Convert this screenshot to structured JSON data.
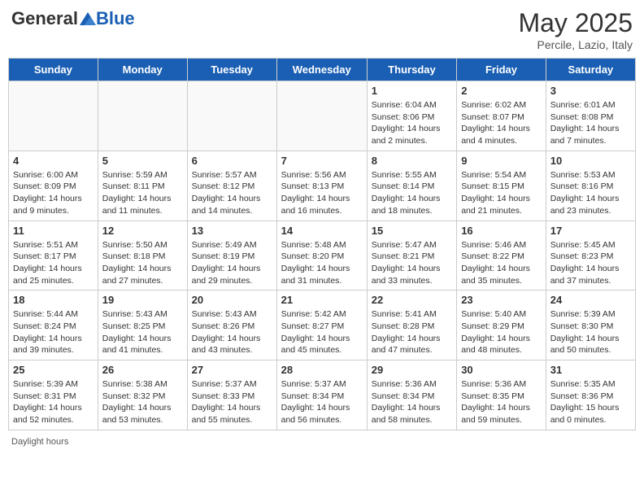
{
  "header": {
    "logo_general": "General",
    "logo_blue": "Blue",
    "month_title": "May 2025",
    "location": "Percile, Lazio, Italy"
  },
  "days_of_week": [
    "Sunday",
    "Monday",
    "Tuesday",
    "Wednesday",
    "Thursday",
    "Friday",
    "Saturday"
  ],
  "weeks": [
    [
      {
        "day": "",
        "info": ""
      },
      {
        "day": "",
        "info": ""
      },
      {
        "day": "",
        "info": ""
      },
      {
        "day": "",
        "info": ""
      },
      {
        "day": "1",
        "info": "Sunrise: 6:04 AM\nSunset: 8:06 PM\nDaylight: 14 hours\nand 2 minutes."
      },
      {
        "day": "2",
        "info": "Sunrise: 6:02 AM\nSunset: 8:07 PM\nDaylight: 14 hours\nand 4 minutes."
      },
      {
        "day": "3",
        "info": "Sunrise: 6:01 AM\nSunset: 8:08 PM\nDaylight: 14 hours\nand 7 minutes."
      }
    ],
    [
      {
        "day": "4",
        "info": "Sunrise: 6:00 AM\nSunset: 8:09 PM\nDaylight: 14 hours\nand 9 minutes."
      },
      {
        "day": "5",
        "info": "Sunrise: 5:59 AM\nSunset: 8:11 PM\nDaylight: 14 hours\nand 11 minutes."
      },
      {
        "day": "6",
        "info": "Sunrise: 5:57 AM\nSunset: 8:12 PM\nDaylight: 14 hours\nand 14 minutes."
      },
      {
        "day": "7",
        "info": "Sunrise: 5:56 AM\nSunset: 8:13 PM\nDaylight: 14 hours\nand 16 minutes."
      },
      {
        "day": "8",
        "info": "Sunrise: 5:55 AM\nSunset: 8:14 PM\nDaylight: 14 hours\nand 18 minutes."
      },
      {
        "day": "9",
        "info": "Sunrise: 5:54 AM\nSunset: 8:15 PM\nDaylight: 14 hours\nand 21 minutes."
      },
      {
        "day": "10",
        "info": "Sunrise: 5:53 AM\nSunset: 8:16 PM\nDaylight: 14 hours\nand 23 minutes."
      }
    ],
    [
      {
        "day": "11",
        "info": "Sunrise: 5:51 AM\nSunset: 8:17 PM\nDaylight: 14 hours\nand 25 minutes."
      },
      {
        "day": "12",
        "info": "Sunrise: 5:50 AM\nSunset: 8:18 PM\nDaylight: 14 hours\nand 27 minutes."
      },
      {
        "day": "13",
        "info": "Sunrise: 5:49 AM\nSunset: 8:19 PM\nDaylight: 14 hours\nand 29 minutes."
      },
      {
        "day": "14",
        "info": "Sunrise: 5:48 AM\nSunset: 8:20 PM\nDaylight: 14 hours\nand 31 minutes."
      },
      {
        "day": "15",
        "info": "Sunrise: 5:47 AM\nSunset: 8:21 PM\nDaylight: 14 hours\nand 33 minutes."
      },
      {
        "day": "16",
        "info": "Sunrise: 5:46 AM\nSunset: 8:22 PM\nDaylight: 14 hours\nand 35 minutes."
      },
      {
        "day": "17",
        "info": "Sunrise: 5:45 AM\nSunset: 8:23 PM\nDaylight: 14 hours\nand 37 minutes."
      }
    ],
    [
      {
        "day": "18",
        "info": "Sunrise: 5:44 AM\nSunset: 8:24 PM\nDaylight: 14 hours\nand 39 minutes."
      },
      {
        "day": "19",
        "info": "Sunrise: 5:43 AM\nSunset: 8:25 PM\nDaylight: 14 hours\nand 41 minutes."
      },
      {
        "day": "20",
        "info": "Sunrise: 5:43 AM\nSunset: 8:26 PM\nDaylight: 14 hours\nand 43 minutes."
      },
      {
        "day": "21",
        "info": "Sunrise: 5:42 AM\nSunset: 8:27 PM\nDaylight: 14 hours\nand 45 minutes."
      },
      {
        "day": "22",
        "info": "Sunrise: 5:41 AM\nSunset: 8:28 PM\nDaylight: 14 hours\nand 47 minutes."
      },
      {
        "day": "23",
        "info": "Sunrise: 5:40 AM\nSunset: 8:29 PM\nDaylight: 14 hours\nand 48 minutes."
      },
      {
        "day": "24",
        "info": "Sunrise: 5:39 AM\nSunset: 8:30 PM\nDaylight: 14 hours\nand 50 minutes."
      }
    ],
    [
      {
        "day": "25",
        "info": "Sunrise: 5:39 AM\nSunset: 8:31 PM\nDaylight: 14 hours\nand 52 minutes."
      },
      {
        "day": "26",
        "info": "Sunrise: 5:38 AM\nSunset: 8:32 PM\nDaylight: 14 hours\nand 53 minutes."
      },
      {
        "day": "27",
        "info": "Sunrise: 5:37 AM\nSunset: 8:33 PM\nDaylight: 14 hours\nand 55 minutes."
      },
      {
        "day": "28",
        "info": "Sunrise: 5:37 AM\nSunset: 8:34 PM\nDaylight: 14 hours\nand 56 minutes."
      },
      {
        "day": "29",
        "info": "Sunrise: 5:36 AM\nSunset: 8:34 PM\nDaylight: 14 hours\nand 58 minutes."
      },
      {
        "day": "30",
        "info": "Sunrise: 5:36 AM\nSunset: 8:35 PM\nDaylight: 14 hours\nand 59 minutes."
      },
      {
        "day": "31",
        "info": "Sunrise: 5:35 AM\nSunset: 8:36 PM\nDaylight: 15 hours\nand 0 minutes."
      }
    ]
  ],
  "footer": "Daylight hours"
}
